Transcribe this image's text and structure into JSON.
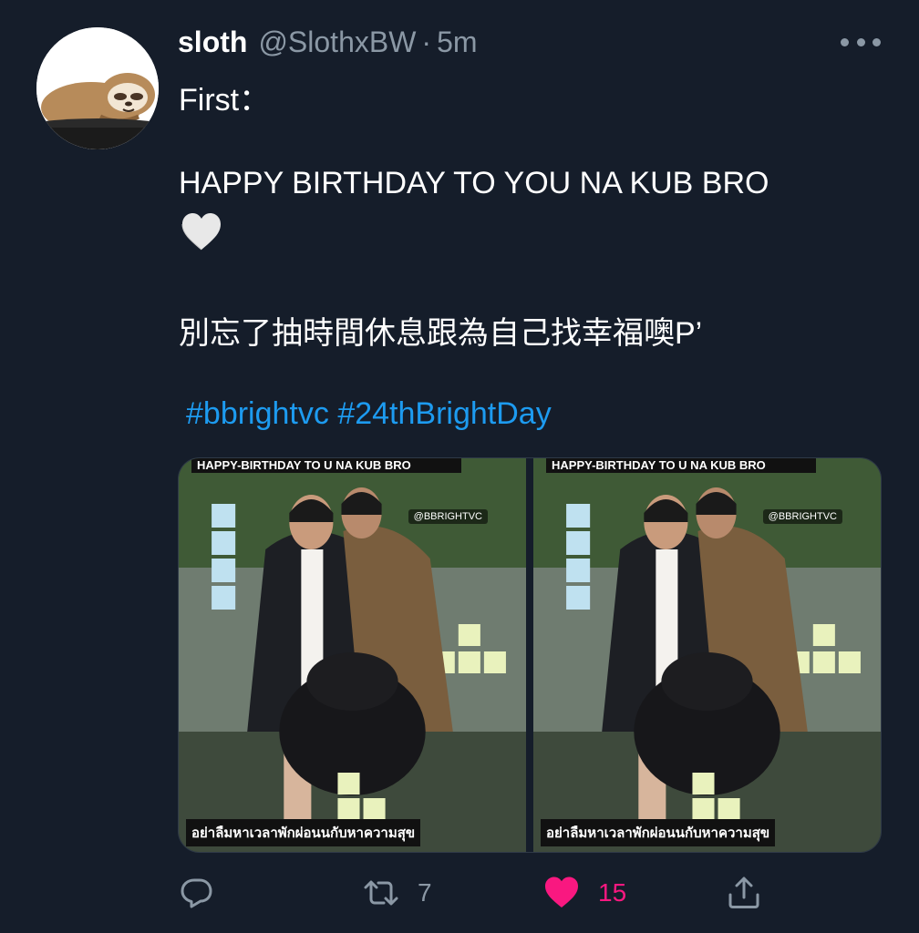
{
  "tweet": {
    "display_name": "sloth",
    "handle": "@SlothxBW",
    "separator": "·",
    "time": "5m",
    "lines": {
      "line1": "First：",
      "line2": "HAPPY BIRTHDAY TO YOU NA KUB BRO",
      "line3": "別忘了抽時間休息跟為自己找幸福噢P’"
    },
    "heart_emoji": "white-heart-icon",
    "hashtags": [
      "#bbrightvc",
      "#24thBrightDay"
    ]
  },
  "media": {
    "photos": [
      {
        "banner": "HAPPY-BIRTHDAY TO U NA KUB BRO",
        "tag": "@BBRIGHTVC",
        "caption": "อย่าลืมหาเวลาพักผ่อนนกับหาความสุข"
      },
      {
        "banner": "HAPPY-BIRTHDAY TO U NA KUB BRO",
        "tag": "@BBRIGHTVC",
        "caption": "อย่าลืมหาเวลาพักผ่อนนกับหาความสุข"
      }
    ]
  },
  "actions": {
    "reply_icon": "reply-icon",
    "retweet_icon": "retweet-icon",
    "retweet_count": "7",
    "like_icon": "heart-filled-icon",
    "like_count": "15",
    "share_icon": "share-icon"
  },
  "colors": {
    "background": "#151d2a",
    "secondary_text": "#8b98a5",
    "link": "#1d9bf0",
    "like": "#f91880"
  }
}
